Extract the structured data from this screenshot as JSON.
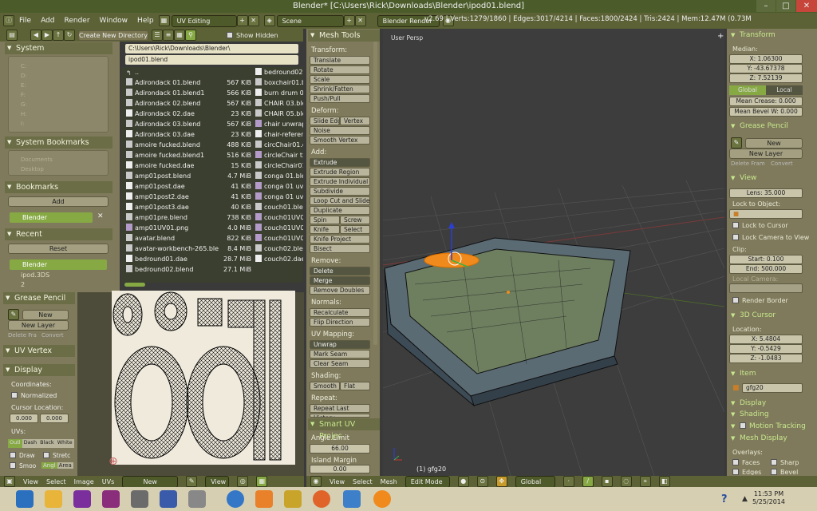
{
  "window": {
    "title": "Blender* [C:\\Users\\Rick\\Downloads\\Blender\\ipod01.blend]"
  },
  "menu": {
    "items": [
      "File",
      "Add",
      "Render",
      "Window",
      "Help"
    ],
    "layout": "UV Editing",
    "scene": "Scene",
    "engine": "Blender Render",
    "stats": "v2.69 | Verts:1279/1860 | Edges:3017/4214 | Faces:1800/2424 | Tris:2424 | Mem:12.47M (0.73M"
  },
  "filebrowser": {
    "create_dir": "Create New Directory",
    "show_hidden": "Show Hidden",
    "path": "C:\\Users\\Rick\\Downloads\\Blender\\",
    "filename": "ipod01.blend",
    "system_header": "System",
    "drives": [
      "C:",
      "D:",
      "E:",
      "F:",
      "G:",
      "H:",
      "I:"
    ],
    "sys_bookmarks_header": "System Bookmarks",
    "sys_bookmarks": [
      "Documents",
      "Desktop"
    ],
    "bookmarks_header": "Bookmarks",
    "add_label": "Add",
    "bookmark_item": "Blender",
    "recent_header": "Recent",
    "reset_label": "Reset",
    "recent_items": [
      "Blender",
      "ipod.3DS",
      "2"
    ],
    "files": [
      {
        "name": "..",
        "size": ""
      },
      {
        "name": "Adirondack 01.blend",
        "size": "567 KiB"
      },
      {
        "name": "Adirondack 01.blend1",
        "size": "566 KiB"
      },
      {
        "name": "Adirondack 02.blend",
        "size": "567 KiB"
      },
      {
        "name": "Adirondack 02.dae",
        "size": "23 KiB"
      },
      {
        "name": "Adirondack 03.blend",
        "size": "567 KiB"
      },
      {
        "name": "Adirondack 03.dae",
        "size": "23 KiB"
      },
      {
        "name": "amoire fucked.blend",
        "size": "488 KiB"
      },
      {
        "name": "amoire fucked.blend1",
        "size": "516 KiB"
      },
      {
        "name": "amoire fucked.dae",
        "size": "15 KiB"
      },
      {
        "name": "amp01post.blend",
        "size": "4.7 MiB"
      },
      {
        "name": "amp01post.dae",
        "size": "41 KiB"
      },
      {
        "name": "amp01post2.dae",
        "size": "41 KiB"
      },
      {
        "name": "amp01post3.dae",
        "size": "40 KiB"
      },
      {
        "name": "amp01pre.blend",
        "size": "738 KiB"
      },
      {
        "name": "amp01UV01.png",
        "size": "4.0 MiB"
      },
      {
        "name": "avatar.blend",
        "size": "822 KiB"
      },
      {
        "name": "avatar-workbench-265.ble",
        "size": "8.4 MiB"
      },
      {
        "name": "bedround01.dae",
        "size": "28.7 MiB"
      },
      {
        "name": "bedround02.blend",
        "size": "27.1 MiB"
      }
    ],
    "files2": [
      "bedround02",
      "boxchair01.b",
      "burn drum 0",
      "CHAIR 03.ble",
      "CHAIR 05.ble",
      "chair unwrap",
      "chair-referen",
      "circChair01.c",
      "circleChair tx",
      "circleChair01",
      "conga 01.blen",
      "conga 01 uv",
      "conga 01 uv",
      "couch01.blen",
      "couch01UV0",
      "couch01UV0",
      "couch01UV0",
      "couch02.blen",
      "couch02.dae"
    ]
  },
  "uv": {
    "grease_pencil": "Grease Pencil",
    "new": "New",
    "new_layer": "New Layer",
    "delete_frame": "Delete Fra",
    "convert": "Convert",
    "uv_vertex": "UV Vertex",
    "display": "Display",
    "coordinates": "Coordinates:",
    "normalized": "Normalized",
    "cursor_location": "Cursor Location:",
    "cx": "0.000",
    "cy": "0.000",
    "uvs": "UVs:",
    "uv_modes": [
      "Outl",
      "Dash",
      "Black",
      "White"
    ],
    "draw": "Draw",
    "stretch": "Stretc",
    "smooth": "Smoo",
    "angle": "Angl",
    "area": "Area",
    "overlay": "Overlays"
  },
  "tools": {
    "header": "Mesh Tools",
    "transform": "Transform:",
    "transform_btns": [
      "Translate",
      "Rotate",
      "Scale",
      "Shrink/Fatten",
      "Push/Pull"
    ],
    "deform": "Deform:",
    "slide_edge": "Slide Edg",
    "vertex": "Vertex",
    "noise": "Noise",
    "smooth_vertex": "Smooth Vertex",
    "add": "Add:",
    "extrude": "Extrude",
    "extrude_region": "Extrude Region",
    "extrude_individual": "Extrude Individual",
    "subdivide": "Subdivide",
    "loop_cut": "Loop Cut and Slide",
    "duplicate": "Duplicate",
    "spin": "Spin",
    "screw": "Screw",
    "knife": "Knife",
    "select": "Select",
    "knife_project": "Knife Project",
    "bisect": "Bisect",
    "remove": "Remove:",
    "delete": "Delete",
    "merge": "Merge",
    "remove_doubles": "Remove Doubles",
    "normals": "Normals:",
    "recalculate": "Recalculate",
    "flip_direction": "Flip Direction",
    "uv_mapping": "UV Mapping:",
    "unwrap": "Unwrap",
    "mark_seam": "Mark Seam",
    "clear_seam": "Clear Seam",
    "shading": "Shading:",
    "smooth": "Smooth",
    "flat": "Flat",
    "repeat": "Repeat:",
    "repeat_last": "Repeat Last",
    "history": "History",
    "smart_uv": "Smart UV Projec",
    "angle_limit": "Angle Limit",
    "angle_value": "66.00",
    "island_margin": "Island Margin",
    "margin_value": "0.00"
  },
  "viewport": {
    "label": "User Persp",
    "object": "(1) gfg20"
  },
  "props": {
    "transform": "Transform",
    "median": "Median:",
    "x": "X: 1.06300",
    "y": "Y: -43.67378",
    "z": "Z: 7.52139",
    "global": "Global",
    "local": "Local",
    "mean_crease": "Mean Crease: 0.000",
    "mean_bevel": "Mean Bevel W: 0.000",
    "grease_pencil": "Grease Pencil",
    "new": "New",
    "new_layer": "New Layer",
    "delete_frame": "Delete Fram",
    "convert": "Convert",
    "view": "View",
    "lens": "Lens: 35.000",
    "lock_object": "Lock to Object:",
    "lock_cursor": "Lock to Cursor",
    "lock_camera": "Lock Camera to View",
    "clip": "Clip:",
    "start": "Start: 0.100",
    "end": "End: 500.000",
    "local_camera": "Local Camera:",
    "render_border": "Render Border",
    "cursor3d": "3D Cursor",
    "location": "Location:",
    "cx": "X: 5.4804",
    "cy": "Y: -0.5429",
    "cz": "Z: -1.0483",
    "item": "Item",
    "item_name": "gfg20",
    "display": "Display",
    "shading": "Shading",
    "motion_tracking": "Motion Tracking",
    "mesh_display": "Mesh Display",
    "overlays": "Overlays:",
    "faces": "Faces",
    "sharp": "Sharp",
    "edges": "Edges",
    "bevel": "Bevel"
  },
  "bottom": {
    "uv_menu": [
      "View",
      "Select",
      "Image",
      "UVs"
    ],
    "image_new": "New",
    "view_dd": "View",
    "vp_menu": [
      "View",
      "Select",
      "Mesh"
    ],
    "mode": "Edit Mode",
    "orientation": "Global"
  },
  "clock": {
    "time": "11:53 PM",
    "date": "5/25/2014"
  }
}
